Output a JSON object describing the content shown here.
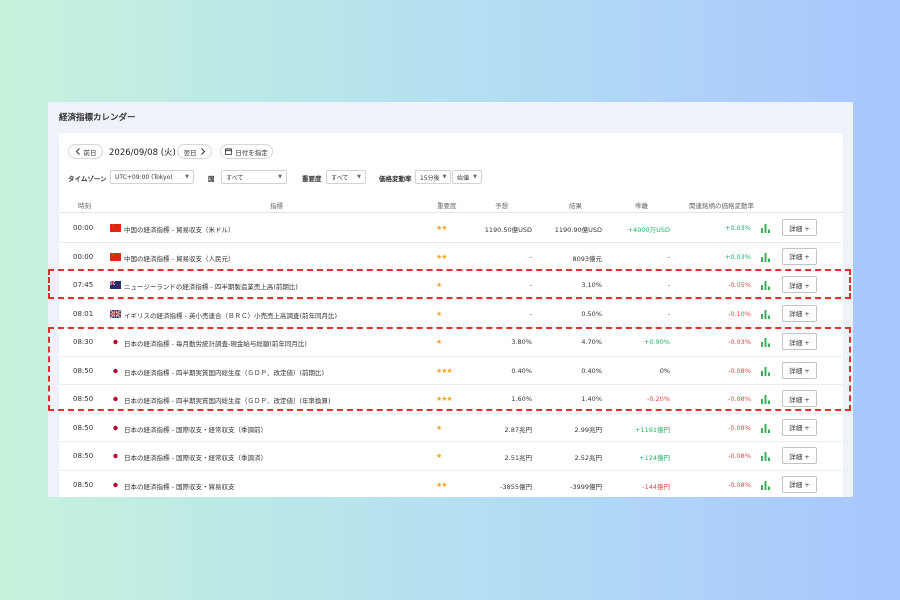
{
  "panel": {
    "title": "経済指標カレンダー"
  },
  "nav": {
    "prev_label": "前日",
    "date": "2026/09/08 (火)",
    "next_label": "翌日",
    "pick_date_label": "日付を指定"
  },
  "filters": {
    "timezone_label": "タイムゾーン",
    "timezone_value": "UTC+09:00 (Tokyo)",
    "country_label": "国",
    "country_value": "すべて",
    "importance_label": "重要度",
    "importance_value": "すべて",
    "volatility_label": "価格変動率",
    "interval_value": "15分後",
    "start_value": "始値"
  },
  "table": {
    "headers": {
      "time": "時刻",
      "indicator": "指標",
      "importance": "重要度",
      "forecast": "予想",
      "result": "結果",
      "deviation": "乖離",
      "price_change": "関連銘柄の価格変動率"
    },
    "detail_label": "詳細 +",
    "rows": [
      {
        "time": "00:00",
        "flag": "cn",
        "indicator": "中国の経済指標 - 貿易収支（米ドル）",
        "importance": "★★",
        "forecast": "1190.50億USD",
        "result": "1190.90億USD",
        "deviation": "+4000万USD",
        "deviation_tone": "green",
        "change": "+0.03%",
        "change_tone": "green"
      },
      {
        "time": "00:00",
        "flag": "cn",
        "indicator": "中国の経済指標 - 貿易収支（人民元）",
        "importance": "★★",
        "forecast": "-",
        "result": "8093億元",
        "deviation": "-",
        "deviation_tone": "",
        "change": "+0.03%",
        "change_tone": "green"
      },
      {
        "time": "07:45",
        "flag": "nz",
        "indicator": "ニュージーランドの経済指標 - 四半期製造業売上高(前期比)",
        "importance": "★",
        "forecast": "-",
        "result": "3.10%",
        "deviation": "-",
        "deviation_tone": "",
        "change": "-0.05%",
        "change_tone": "red"
      },
      {
        "time": "08:01",
        "flag": "uk",
        "indicator": "イギリスの経済指標 - 英小売連合（ＢＲＣ）小売売上高調査(前年同月比)",
        "importance": "★",
        "forecast": "-",
        "result": "0.50%",
        "deviation": "-",
        "deviation_tone": "",
        "change": "-0.10%",
        "change_tone": "red"
      },
      {
        "time": "08:30",
        "flag": "jp",
        "indicator": "日本の経済指標 - 毎月勤労統計調査-現金給与総額(前年同月比)",
        "importance": "★",
        "forecast": "3.80%",
        "result": "4.70%",
        "deviation": "+0.90%",
        "deviation_tone": "green",
        "change": "-0.03%",
        "change_tone": "red"
      },
      {
        "time": "08:50",
        "flag": "jp",
        "indicator": "日本の経済指標 - 四半期実質国内総生産（ＧＤＰ、改定値）(前期比)",
        "importance": "★★★",
        "forecast": "0.40%",
        "result": "0.40%",
        "deviation": "0%",
        "deviation_tone": "",
        "change": "-0.08%",
        "change_tone": "red"
      },
      {
        "time": "08:50",
        "flag": "jp",
        "indicator": "日本の経済指標 - 四半期実質国内総生産（ＧＤＰ、改定値）(年率換算)",
        "importance": "★★★",
        "forecast": "1.60%",
        "result": "1.40%",
        "deviation": "-0.20%",
        "deviation_tone": "red",
        "change": "-0.08%",
        "change_tone": "red"
      },
      {
        "time": "08:50",
        "flag": "jp",
        "indicator": "日本の経済指標 - 国際収支・経常収支（季調前）",
        "importance": "★",
        "forecast": "2.87兆円",
        "result": "2.99兆円",
        "deviation": "+1191億円",
        "deviation_tone": "green",
        "change": "-0.08%",
        "change_tone": "red"
      },
      {
        "time": "08:50",
        "flag": "jp",
        "indicator": "日本の経済指標 - 国際収支・経常収支（季調済）",
        "importance": "★",
        "forecast": "2.51兆円",
        "result": "2.52兆円",
        "deviation": "+124億円",
        "deviation_tone": "green",
        "change": "-0.08%",
        "change_tone": "red"
      },
      {
        "time": "08:50",
        "flag": "jp",
        "indicator": "日本の経済指標 - 国際収支・貿易収支",
        "importance": "★★",
        "forecast": "-3855億円",
        "result": "-3999億円",
        "deviation": "-144億円",
        "deviation_tone": "red",
        "change": "-0.08%",
        "change_tone": "red"
      }
    ]
  },
  "colors": {
    "accent_red": "#e03030",
    "positive": "#1db46a",
    "negative": "#e04747",
    "star": "#f5a623"
  }
}
